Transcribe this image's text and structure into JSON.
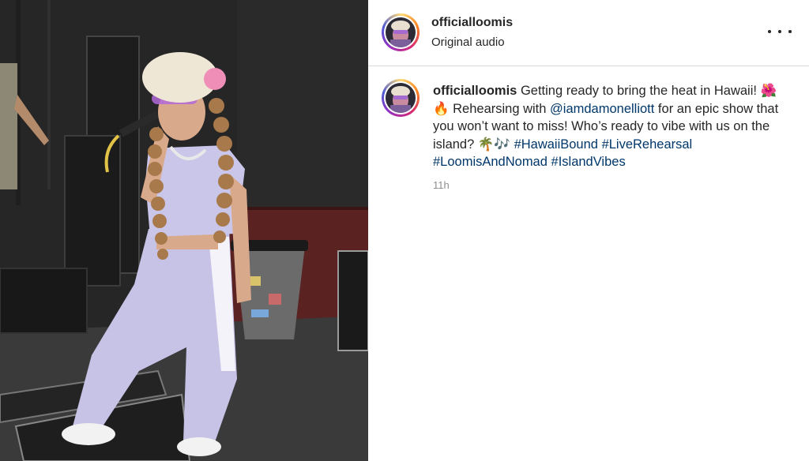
{
  "post": {
    "username": "officialloomis",
    "audio": "Original audio",
    "more_icon": "more-horizontal-icon",
    "caption": {
      "text1": "Getting ready to bring the heat in Hawaii! ",
      "emoji1": "🌺🔥",
      "text2": " Rehearsing with ",
      "mention": "@iamdamonelliott",
      "text3": " for an epic show that you won’t want to miss! Who’s ready to vibe with us on the island? ",
      "emoji2": "🌴🎶",
      "hashtags": [
        "#HawaiiBound",
        "#LiveRehearsal",
        "#LoomisAndNomad",
        "#IslandVibes"
      ]
    },
    "time": "11h"
  },
  "colors": {
    "link": "#00376b",
    "muted": "#8e8e8e",
    "text": "#262626",
    "divider": "#dbdbdb"
  }
}
